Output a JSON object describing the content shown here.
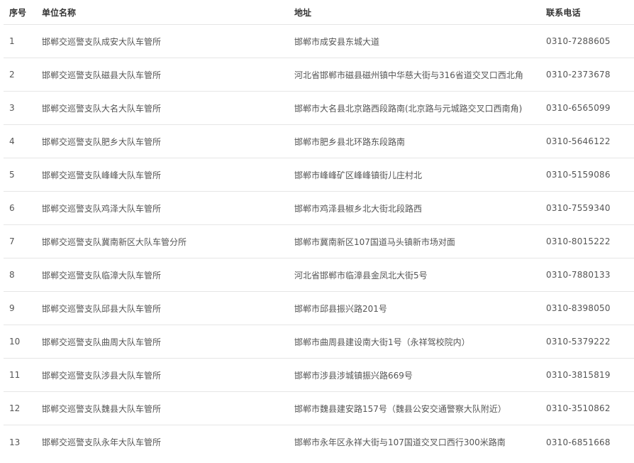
{
  "table": {
    "headers": {
      "no": "序号",
      "name": "单位名称",
      "address": "地址",
      "phone": "联系电话"
    },
    "rows": [
      {
        "no": "1",
        "name": "邯郸交巡警支队成安大队车管所",
        "address": "邯郸市成安县东城大道",
        "phone": "0310-7288605"
      },
      {
        "no": "2",
        "name": "邯郸交巡警支队磁县大队车管所",
        "address": "河北省邯郸市磁县磁州镇中华慈大街与316省道交叉口西北角",
        "phone": "0310-2373678"
      },
      {
        "no": "3",
        "name": "邯郸交巡警支队大名大队车管所",
        "address": "邯郸市大名县北京路西段路南(北京路与元城路交叉口西南角)",
        "phone": "0310-6565099"
      },
      {
        "no": "4",
        "name": "邯郸交巡警支队肥乡大队车管所",
        "address": "邯郸市肥乡县北环路东段路南",
        "phone": "0310-5646122"
      },
      {
        "no": "5",
        "name": "邯郸交巡警支队峰峰大队车管所",
        "address": "邯郸市峰峰矿区峰峰镇街儿庄村北",
        "phone": "0310-5159086"
      },
      {
        "no": "6",
        "name": "邯郸交巡警支队鸡泽大队车管所",
        "address": "邯郸市鸡泽县椒乡北大街北段路西",
        "phone": "0310-7559340"
      },
      {
        "no": "7",
        "name": "邯郸交巡警支队冀南新区大队车管分所",
        "address": "邯郸市冀南新区107国道马头镇新市场对面",
        "phone": "0310-8015222"
      },
      {
        "no": "8",
        "name": "邯郸交巡警支队临漳大队车管所",
        "address": "河北省邯郸市临漳县金凤北大街5号",
        "phone": "0310-7880133"
      },
      {
        "no": "9",
        "name": "邯郸交巡警支队邱县大队车管所",
        "address": "邯郸市邱县振兴路201号",
        "phone": "0310-8398050"
      },
      {
        "no": "10",
        "name": "邯郸交巡警支队曲周大队车管所",
        "address": "邯郸市曲周县建设南大街1号（永祥驾校院内）",
        "phone": "0310-5379222"
      },
      {
        "no": "11",
        "name": "邯郸交巡警支队涉县大队车管所",
        "address": "邯郸市涉县涉城镇振兴路669号",
        "phone": "0310-3815819"
      },
      {
        "no": "12",
        "name": "邯郸交巡警支队魏县大队车管所",
        "address": "邯郸市魏县建安路157号（魏县公安交通警察大队附近）",
        "phone": "0310-3510862"
      },
      {
        "no": "13",
        "name": "邯郸交巡警支队永年大队车管所",
        "address": "邯郸市永年区永祥大街与107国道交叉口西行300米路南",
        "phone": "0310-6851668"
      }
    ]
  }
}
